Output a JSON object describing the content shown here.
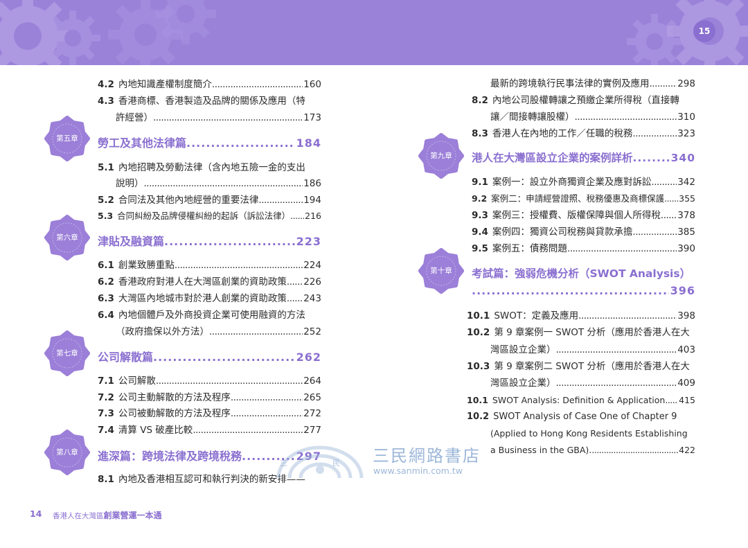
{
  "header": {
    "page_badge": "15"
  },
  "footer": {
    "page_number": "14",
    "book_title_prefix": "香港人在大灣區",
    "book_title_main": "創業營運一本通"
  },
  "watermark": {
    "store_name": "三民網路書店",
    "url": "www.sanmin.com.tw",
    "logo_letters": [
      "三",
      "民"
    ]
  },
  "left": {
    "entries": [
      {
        "num": "4.2",
        "title": "內地知識產權制度簡介",
        "page": "160"
      },
      {
        "num": "4.3",
        "title": "香港商標、香港製造及品牌的關係及應用（特",
        "continuation": "許經營）",
        "page": "173"
      },
      {
        "num": "5.1",
        "title": "內地招聘及勞動法律（含內地五險一金的支出",
        "continuation": "說明）",
        "page": "186"
      },
      {
        "num": "5.2",
        "title": "合同法及其他內地經營的重要法律",
        "page": "194"
      },
      {
        "num": "5.3",
        "title": "合同糾紛及品牌侵權糾紛的起訴（訴訟法律）",
        "page": "216"
      },
      {
        "num": "6.1",
        "title": "創業致勝重點",
        "page": "224"
      },
      {
        "num": "6.2",
        "title": "香港政府對港人在大灣區創業的資助政策",
        "page": "226"
      },
      {
        "num": "6.3",
        "title": "大灣區內地城市對於港人創業的資助政策",
        "page": "243"
      },
      {
        "num": "6.4",
        "title": "內地個體戶及外商投資企業可使用融資的方法",
        "continuation": "（政府擔保以外方法）",
        "page": "252"
      },
      {
        "num": "7.1",
        "title": "公司解散",
        "page": "264"
      },
      {
        "num": "7.2",
        "title": "公司主動解散的方法及程序",
        "page": "265"
      },
      {
        "num": "7.3",
        "title": "公司被動解散的方法及程序",
        "page": "272"
      },
      {
        "num": "7.4",
        "title": "清算 VS 破產比較",
        "page": "277"
      },
      {
        "num": "8.1",
        "title": "內地及香港相互認可和執行判決的新安排——"
      }
    ],
    "chapters": [
      {
        "badge": "第五章",
        "title": "勞工及其他法律篇",
        "page": "184"
      },
      {
        "badge": "第六章",
        "title": "津貼及融資篇",
        "page": "223"
      },
      {
        "badge": "第七章",
        "title": "公司解散篇",
        "page": "262"
      },
      {
        "badge": "第八章",
        "title": "進深篇：跨境法律及跨境稅務",
        "page": "297"
      }
    ]
  },
  "right": {
    "entries": [
      {
        "num": "",
        "title": "最新的跨境執行民事法律的實例及應用",
        "page": "298"
      },
      {
        "num": "8.2",
        "title": "內地公司股權轉讓之預繳企業所得稅（直接轉",
        "continuation": "讓／間接轉讓股權）",
        "page": "310"
      },
      {
        "num": "8.3",
        "title": "香港人在內地的工作／任職的稅務",
        "page": "323"
      },
      {
        "num": "9.1",
        "title": "案例一：設立外商獨資企業及應對訴訟",
        "page": "342"
      },
      {
        "num": "9.2",
        "title": "案例二：申請經營證照、稅務優惠及商標保護",
        "page": "355"
      },
      {
        "num": "9.3",
        "title": "案例三：授權費、版權保障與個人所得稅",
        "page": "378"
      },
      {
        "num": "9.4",
        "title": "案例四：獨資公司稅務與貸款承擔",
        "page": "385"
      },
      {
        "num": "9.5",
        "title": "案例五：債務問題",
        "page": "390"
      },
      {
        "num": "10.1",
        "title": "SWOT：定義及應用",
        "page": "398"
      },
      {
        "num": "10.2",
        "title": "第 9 章案例一 SWOT 分析（應用於香港人在大",
        "continuation": "灣區設立企業）",
        "page": "403"
      },
      {
        "num": "10.3",
        "title": "第 9 章案例二 SWOT 分析（應用於香港人在大",
        "continuation": "灣區設立企業）",
        "page": "409"
      },
      {
        "num": "10.1",
        "title": "SWOT Analysis: Definition & Application",
        "page": "415"
      },
      {
        "num": "10.2",
        "title": "SWOT Analysis of Case One of Chapter 9",
        "continuation": "(Applied to Hong Kong Residents Establishing",
        "continuation2": "a Business in the GBA).",
        "page": "422"
      }
    ],
    "chapters": [
      {
        "badge": "第九章",
        "title": "港人在大灣區設立企業的案例詳析",
        "page": "340"
      },
      {
        "badge": "第十章",
        "title": "考試篇：強弱危機分析（SWOT Analysis）",
        "page": "396"
      }
    ]
  },
  "colors": {
    "banner": "#9a82d9",
    "accent": "#8a6fd0",
    "badge": "#9b7fd8"
  }
}
